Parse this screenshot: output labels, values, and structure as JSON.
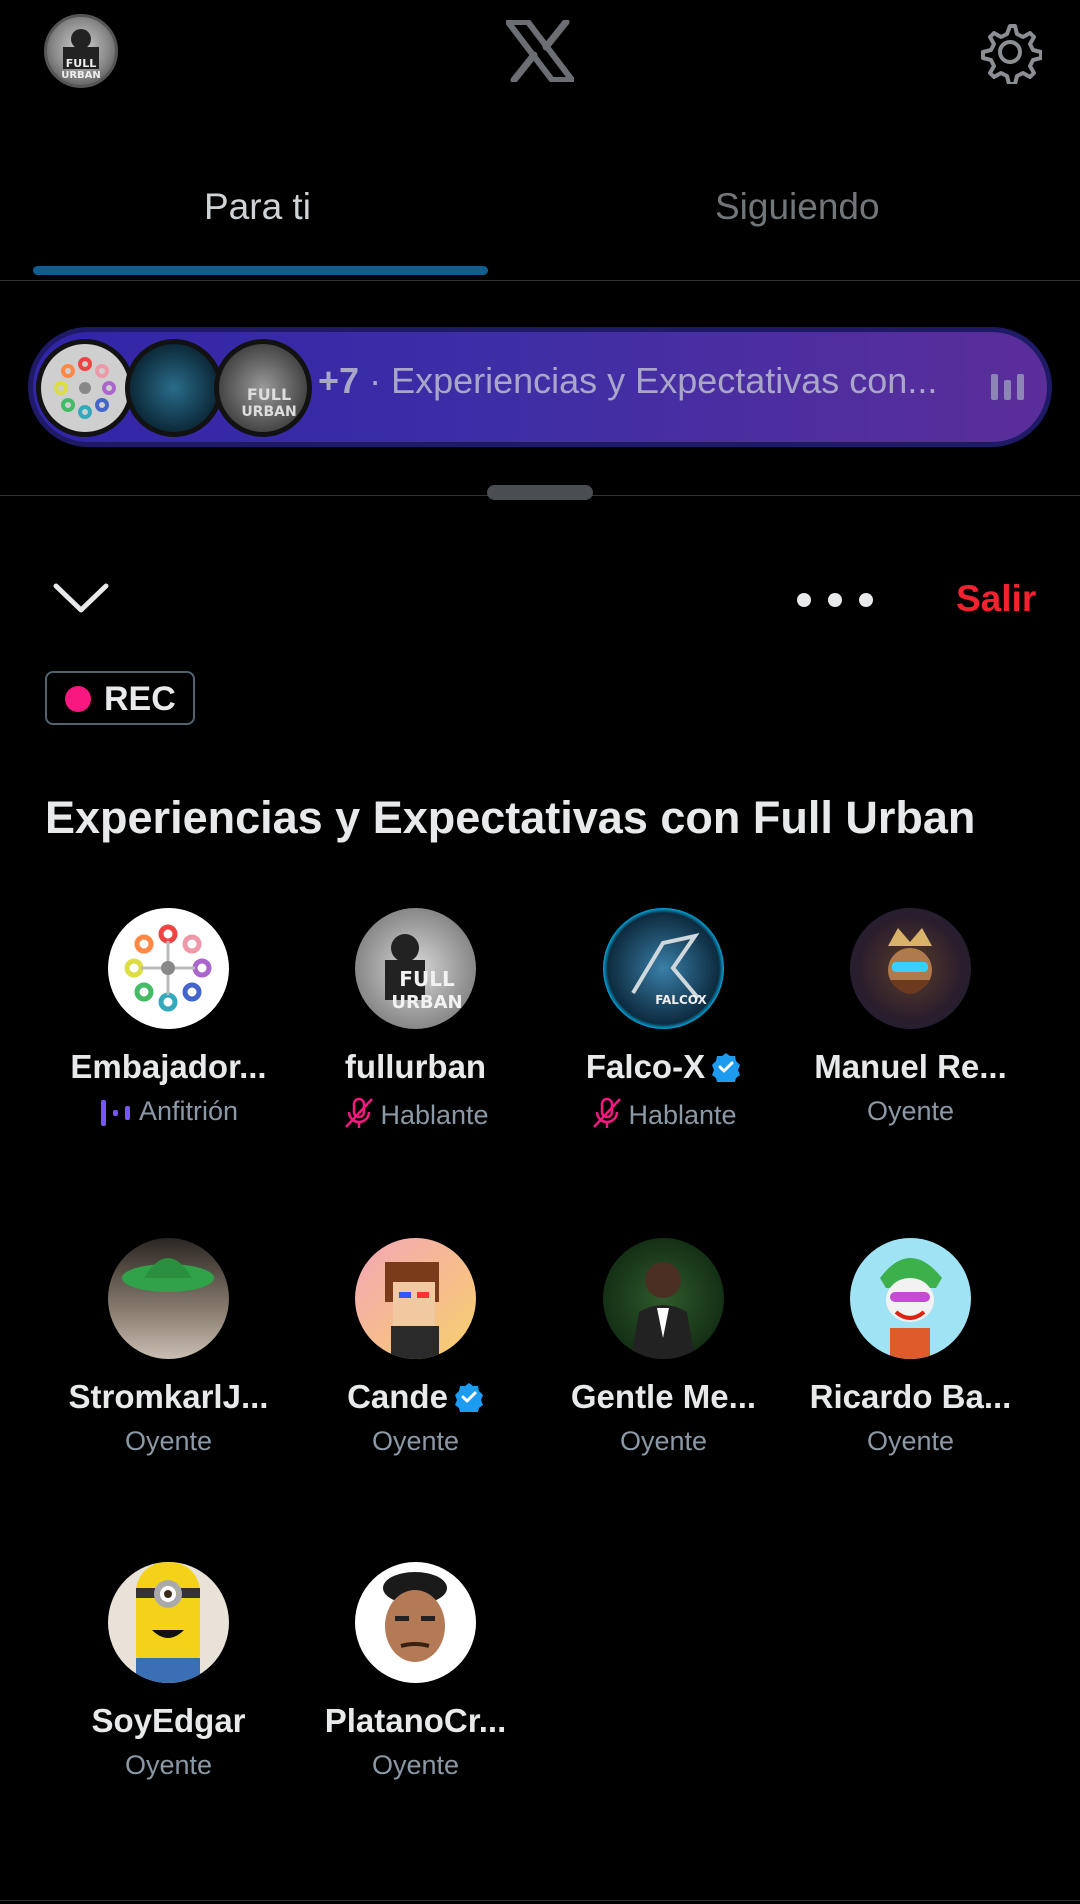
{
  "header": {
    "logo_icon": "x-logo-icon",
    "settings_icon": "gear-icon"
  },
  "tabs": [
    {
      "label": "Para ti",
      "active": true
    },
    {
      "label": "Siguiendo",
      "active": false
    }
  ],
  "space_pill": {
    "more_count": "+7",
    "separator": "·",
    "title_truncated": "Experiencias y Expectativas con..."
  },
  "controls": {
    "collapse_icon": "chevron-down-icon",
    "more_icon": "more-dots-icon",
    "leave_label": "Salir"
  },
  "rec_badge": {
    "label": "REC"
  },
  "space": {
    "title": "Experiencias y Expectativas con Full Urban",
    "participants": [
      {
        "name": "Embajador...",
        "role": "Anfitrión",
        "role_icon": "speaking-bars-icon",
        "verified": false
      },
      {
        "name": "fullurban",
        "role": "Hablante",
        "role_icon": "mic-muted-icon",
        "verified": false
      },
      {
        "name": "Falco-X",
        "role": "Hablante",
        "role_icon": "mic-muted-icon",
        "verified": true
      },
      {
        "name": "Manuel Re...",
        "role": "Oyente",
        "verified": false
      },
      {
        "name": "StromkarlJ...",
        "role": "Oyente",
        "verified": false
      },
      {
        "name": "Cande",
        "role": "Oyente",
        "verified": true
      },
      {
        "name": "Gentle Me...",
        "role": "Oyente",
        "verified": false
      },
      {
        "name": "Ricardo Ba...",
        "role": "Oyente",
        "verified": false
      },
      {
        "name": "SoyEdgar",
        "role": "Oyente",
        "verified": false
      },
      {
        "name": "PlatanoCr...",
        "role": "Oyente",
        "verified": false
      }
    ]
  },
  "colors": {
    "accent": "#1d9bf0",
    "leave": "#f4212e",
    "rec": "#f91880",
    "muted_mic": "#f91880",
    "host_bars": "#7856ff"
  }
}
